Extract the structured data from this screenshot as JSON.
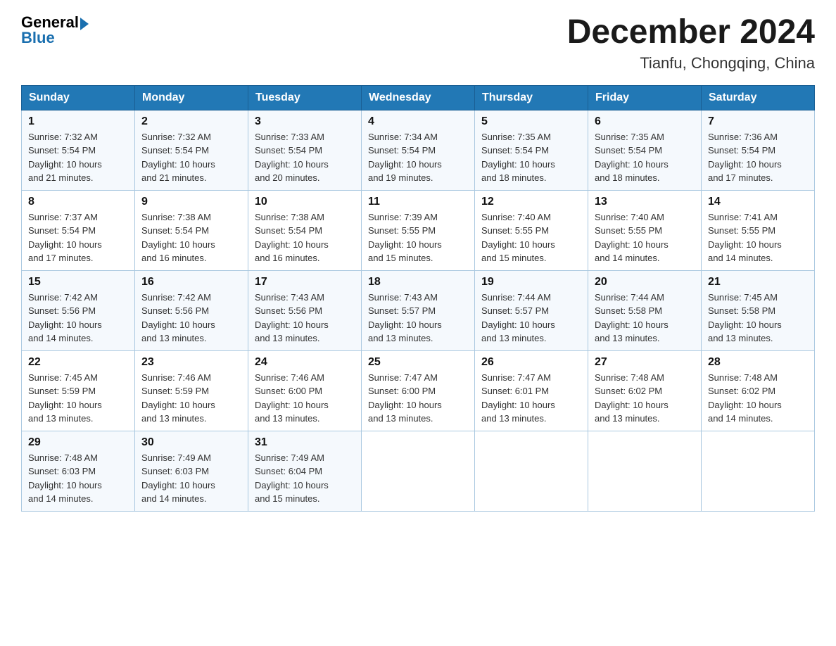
{
  "header": {
    "title": "December 2024",
    "subtitle": "Tianfu, Chongqing, China",
    "logo_general": "General",
    "logo_blue": "Blue"
  },
  "days_of_week": [
    "Sunday",
    "Monday",
    "Tuesday",
    "Wednesday",
    "Thursday",
    "Friday",
    "Saturday"
  ],
  "weeks": [
    [
      {
        "day": "1",
        "sunrise": "7:32 AM",
        "sunset": "5:54 PM",
        "daylight": "10 hours and 21 minutes."
      },
      {
        "day": "2",
        "sunrise": "7:32 AM",
        "sunset": "5:54 PM",
        "daylight": "10 hours and 21 minutes."
      },
      {
        "day": "3",
        "sunrise": "7:33 AM",
        "sunset": "5:54 PM",
        "daylight": "10 hours and 20 minutes."
      },
      {
        "day": "4",
        "sunrise": "7:34 AM",
        "sunset": "5:54 PM",
        "daylight": "10 hours and 19 minutes."
      },
      {
        "day": "5",
        "sunrise": "7:35 AM",
        "sunset": "5:54 PM",
        "daylight": "10 hours and 18 minutes."
      },
      {
        "day": "6",
        "sunrise": "7:35 AM",
        "sunset": "5:54 PM",
        "daylight": "10 hours and 18 minutes."
      },
      {
        "day": "7",
        "sunrise": "7:36 AM",
        "sunset": "5:54 PM",
        "daylight": "10 hours and 17 minutes."
      }
    ],
    [
      {
        "day": "8",
        "sunrise": "7:37 AM",
        "sunset": "5:54 PM",
        "daylight": "10 hours and 17 minutes."
      },
      {
        "day": "9",
        "sunrise": "7:38 AM",
        "sunset": "5:54 PM",
        "daylight": "10 hours and 16 minutes."
      },
      {
        "day": "10",
        "sunrise": "7:38 AM",
        "sunset": "5:54 PM",
        "daylight": "10 hours and 16 minutes."
      },
      {
        "day": "11",
        "sunrise": "7:39 AM",
        "sunset": "5:55 PM",
        "daylight": "10 hours and 15 minutes."
      },
      {
        "day": "12",
        "sunrise": "7:40 AM",
        "sunset": "5:55 PM",
        "daylight": "10 hours and 15 minutes."
      },
      {
        "day": "13",
        "sunrise": "7:40 AM",
        "sunset": "5:55 PM",
        "daylight": "10 hours and 14 minutes."
      },
      {
        "day": "14",
        "sunrise": "7:41 AM",
        "sunset": "5:55 PM",
        "daylight": "10 hours and 14 minutes."
      }
    ],
    [
      {
        "day": "15",
        "sunrise": "7:42 AM",
        "sunset": "5:56 PM",
        "daylight": "10 hours and 14 minutes."
      },
      {
        "day": "16",
        "sunrise": "7:42 AM",
        "sunset": "5:56 PM",
        "daylight": "10 hours and 13 minutes."
      },
      {
        "day": "17",
        "sunrise": "7:43 AM",
        "sunset": "5:56 PM",
        "daylight": "10 hours and 13 minutes."
      },
      {
        "day": "18",
        "sunrise": "7:43 AM",
        "sunset": "5:57 PM",
        "daylight": "10 hours and 13 minutes."
      },
      {
        "day": "19",
        "sunrise": "7:44 AM",
        "sunset": "5:57 PM",
        "daylight": "10 hours and 13 minutes."
      },
      {
        "day": "20",
        "sunrise": "7:44 AM",
        "sunset": "5:58 PM",
        "daylight": "10 hours and 13 minutes."
      },
      {
        "day": "21",
        "sunrise": "7:45 AM",
        "sunset": "5:58 PM",
        "daylight": "10 hours and 13 minutes."
      }
    ],
    [
      {
        "day": "22",
        "sunrise": "7:45 AM",
        "sunset": "5:59 PM",
        "daylight": "10 hours and 13 minutes."
      },
      {
        "day": "23",
        "sunrise": "7:46 AM",
        "sunset": "5:59 PM",
        "daylight": "10 hours and 13 minutes."
      },
      {
        "day": "24",
        "sunrise": "7:46 AM",
        "sunset": "6:00 PM",
        "daylight": "10 hours and 13 minutes."
      },
      {
        "day": "25",
        "sunrise": "7:47 AM",
        "sunset": "6:00 PM",
        "daylight": "10 hours and 13 minutes."
      },
      {
        "day": "26",
        "sunrise": "7:47 AM",
        "sunset": "6:01 PM",
        "daylight": "10 hours and 13 minutes."
      },
      {
        "day": "27",
        "sunrise": "7:48 AM",
        "sunset": "6:02 PM",
        "daylight": "10 hours and 13 minutes."
      },
      {
        "day": "28",
        "sunrise": "7:48 AM",
        "sunset": "6:02 PM",
        "daylight": "10 hours and 14 minutes."
      }
    ],
    [
      {
        "day": "29",
        "sunrise": "7:48 AM",
        "sunset": "6:03 PM",
        "daylight": "10 hours and 14 minutes."
      },
      {
        "day": "30",
        "sunrise": "7:49 AM",
        "sunset": "6:03 PM",
        "daylight": "10 hours and 14 minutes."
      },
      {
        "day": "31",
        "sunrise": "7:49 AM",
        "sunset": "6:04 PM",
        "daylight": "10 hours and 15 minutes."
      },
      null,
      null,
      null,
      null
    ]
  ],
  "labels": {
    "sunrise": "Sunrise:",
    "sunset": "Sunset:",
    "daylight": "Daylight:"
  }
}
